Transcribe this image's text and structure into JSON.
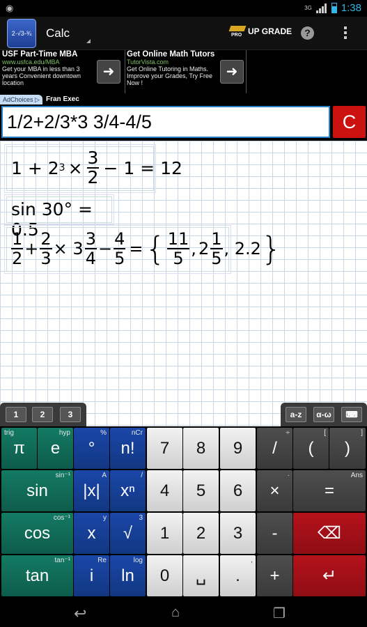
{
  "status": {
    "time": "1:38",
    "network": "3G"
  },
  "app": {
    "title": "Calc",
    "logo_text": "2·√3-¾",
    "upgrade_label": "UP GRADE",
    "pro_label": "PRO",
    "help_glyph": "?"
  },
  "ads": [
    {
      "headline": "USF Part-Time MBA",
      "url": "www.usfca.edu/MBA",
      "body": "Get your MBA in less than 3 years Convenient downtown location"
    },
    {
      "headline": "Get Online Math Tutors",
      "url": "TutorVista.com",
      "body": "Get Online Tutoring in Maths. Improve your Grades, Try Free Now !"
    }
  ],
  "adchoices": "AdChoices",
  "ad_sponsor": "Fran Exec",
  "input": {
    "expression": "1/2+2/3*3 3/4-4/5",
    "clear_label": "C"
  },
  "results": {
    "r1": {
      "a": "1 + 2",
      "exp": "3",
      "times": "×",
      "num": "3",
      "den": "2",
      "rest": "− 1 = 12"
    },
    "r2": "sin 30° = 0.5",
    "r3": {
      "f1n": "1",
      "f1d": "2",
      "plus": "+",
      "f2n": "2",
      "f2d": "3",
      "mult": "× 3",
      "f3n": "3",
      "f3d": "4",
      "minus": "−",
      "f4n": "4",
      "f4d": "5",
      "eq": "=",
      "lb": "{",
      "f5n": "11",
      "f5d": "5",
      "c1": ",",
      "w": "2",
      "f6n": "1",
      "f6d": "5",
      "tail": ", 2.2",
      "rb": "}"
    }
  },
  "tabs": {
    "left": [
      "1",
      "2",
      "3"
    ],
    "right": [
      "a-z",
      "α-ω",
      "⌨"
    ]
  },
  "keys": {
    "row1": [
      {
        "label": "π",
        "sec": "trig"
      },
      {
        "label": "e",
        "sec": "hyp"
      },
      {
        "label": "°",
        "sec": "%"
      },
      {
        "label": "n!",
        "sec": "nCr"
      },
      {
        "label": "7"
      },
      {
        "label": "8"
      },
      {
        "label": "9"
      },
      {
        "label": "/",
        "sec": "÷"
      },
      {
        "label": "(",
        "sec": "["
      },
      {
        "label": ")",
        "sec": "]"
      }
    ],
    "row2": [
      {
        "label": "sin",
        "sec": "sin⁻¹"
      },
      {
        "label": "|x|",
        "sec": "A"
      },
      {
        "label": "xⁿ",
        "sec": "/"
      },
      {
        "label": "4"
      },
      {
        "label": "5"
      },
      {
        "label": "6"
      },
      {
        "label": "×",
        "sec": "·"
      },
      {
        "label": "=",
        "sec": "Ans"
      }
    ],
    "row3": [
      {
        "label": "cos",
        "sec": "cos⁻¹"
      },
      {
        "label": "x",
        "sec": "y"
      },
      {
        "label": "√",
        "sec": "3"
      },
      {
        "label": "1"
      },
      {
        "label": "2"
      },
      {
        "label": "3"
      },
      {
        "label": "-"
      },
      {
        "label": "⌫"
      }
    ],
    "row4": [
      {
        "label": "tan",
        "sec": "tan⁻¹"
      },
      {
        "label": "i",
        "sec": "Re"
      },
      {
        "label": "ln",
        "sec": "log"
      },
      {
        "label": "0"
      },
      {
        "label": "␣"
      },
      {
        "label": ".",
        "sec": ","
      },
      {
        "label": "+"
      },
      {
        "label": "↵"
      }
    ]
  },
  "colors": {
    "accent": "#33b5e5",
    "clear": "#c11111",
    "green_key": "#137a63",
    "blue_key": "#1a47a8",
    "red_key": "#b5121b"
  }
}
